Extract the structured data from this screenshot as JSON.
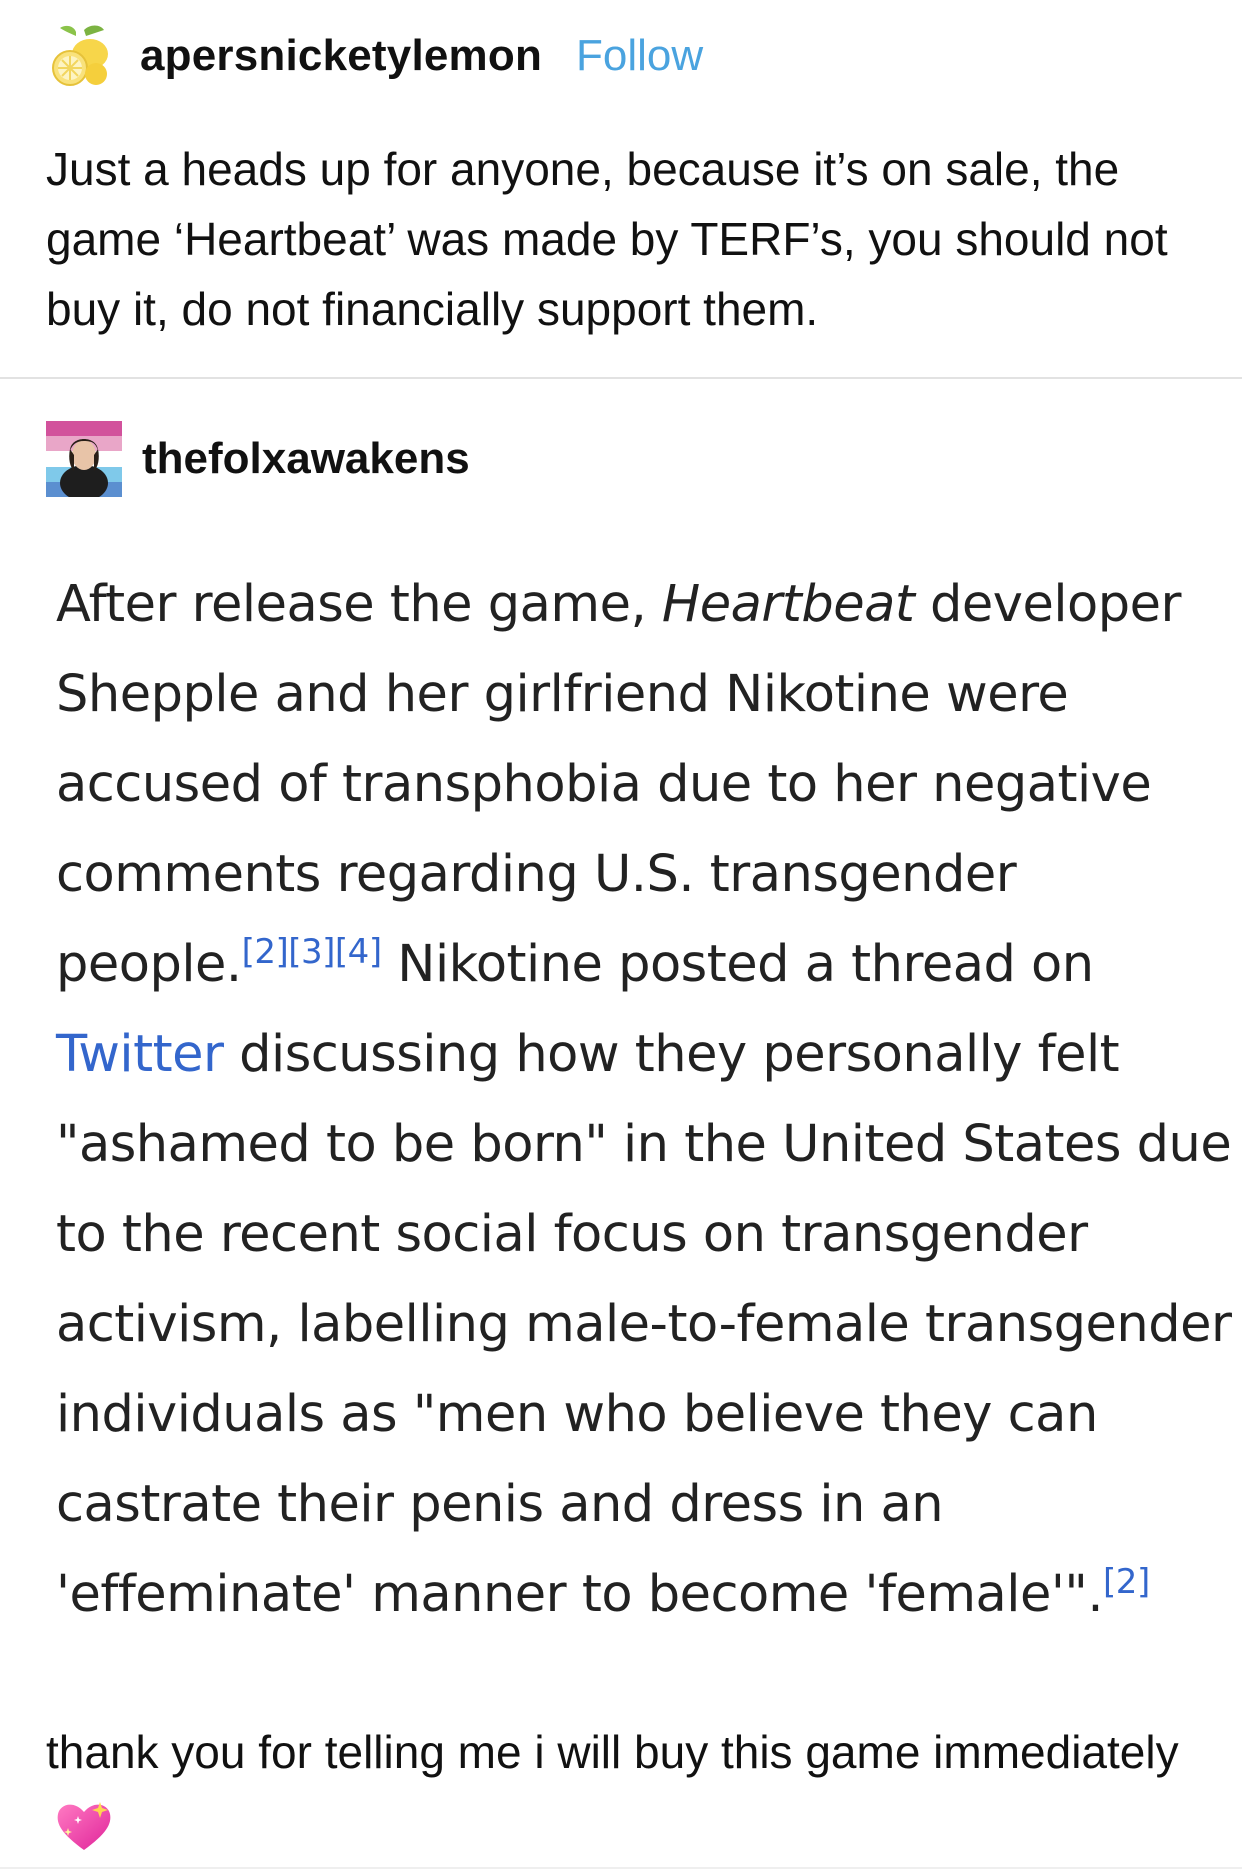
{
  "post": {
    "author": "apersnicketylemon",
    "follow_label": "Follow",
    "avatar_icon": "lemon-icon",
    "body": "Just a heads up for anyone, because it’s on sale, the game ‘Heartbeat’ was made by TERF’s, you should not buy it, do not financially support them."
  },
  "reblog": {
    "author": "thefolxawakens",
    "avatar_icon": "user-avatar-trans-flag",
    "quote": {
      "l1_a": "After release the game, ",
      "l1_italic": "Heartbeat",
      "l1_b": " developer",
      "l2": "Shepple and her girlfriend Nikotine were",
      "l3": "accused of transphobia due to her negative",
      "l4": "comments regarding U.S. transgender",
      "l5_a": "people.",
      "l5_refs": "[2][3][4]",
      "l5_b": " Nikotine posted a thread on",
      "l6_link": "Twitter",
      "l6_b": " discussing how they personally felt",
      "l7": "\"ashamed to be born\" in the United States due",
      "l8": "to the recent social focus on transgender",
      "l9": "activism, labelling male-to-female transgender",
      "l10": "individuals as \"men who believe they can",
      "l11": "castrate their penis and dress in an",
      "l12_a": "'effeminate' manner to become 'female'\".",
      "l12_ref": "[2]"
    },
    "reply": "thank you for telling me i will buy this game immediately",
    "reply_emoji": "sparkling-heart-icon"
  },
  "colors": {
    "link": "#4aa3df",
    "wiki_link": "#3366cc",
    "text": "#111111",
    "divider": "#e2e2e2"
  }
}
